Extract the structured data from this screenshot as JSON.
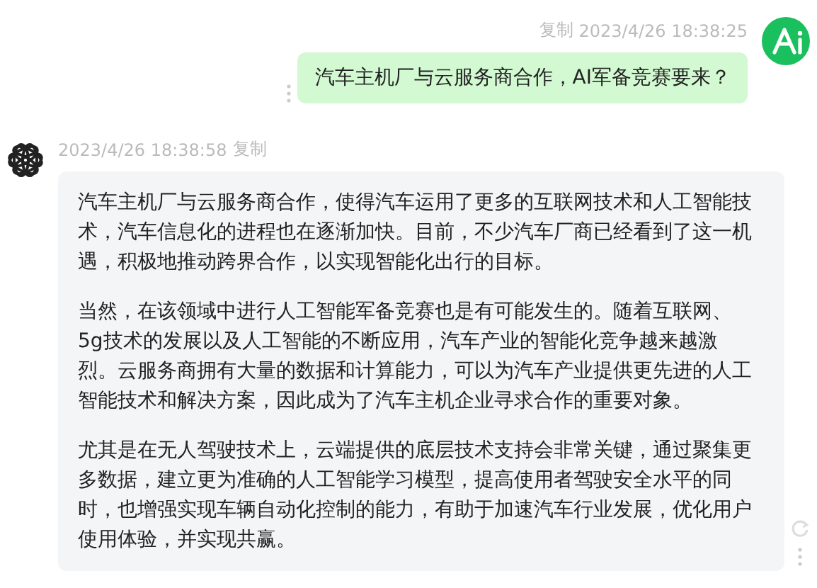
{
  "messages": [
    {
      "kind": "user",
      "copy_label": "复制",
      "timestamp": "2023/4/26 18:38:25",
      "text": "汽车主机厂与云服务商合作，AI军备竞赛要来？"
    },
    {
      "kind": "assistant",
      "copy_label": "复制",
      "timestamp": "2023/4/26 18:38:58",
      "paragraphs": [
        "汽车主机厂与云服务商合作，使得汽车运用了更多的互联网技术和人工智能技术，汽车信息化的进程也在逐渐加快。目前，不少汽车厂商已经看到了这一机遇，积极地推动跨界合作，以实现智能化出行的目标。",
        "当然，在该领域中进行人工智能军备竞赛也是有可能发生的。随着互联网、5g技术的发展以及人工智能的不断应用，汽车产业的智能化竞争越来越激烈。云服务商拥有大量的数据和计算能力，可以为汽车产业提供更先进的人工智能技术和解决方案，因此成为了汽车主机企业寻求合作的重要对象。",
        "尤其是在无人驾驶技术上，云端提供的底层技术支持会非常关键，通过聚集更多数据，建立更为准确的人工智能学习模型，提高使用者驾驶安全水平的同时，也增强实现车辆自动化控制的能力，有助于加速汽车行业发展，优化用户使用体验，并实现共赢。"
      ]
    }
  ]
}
